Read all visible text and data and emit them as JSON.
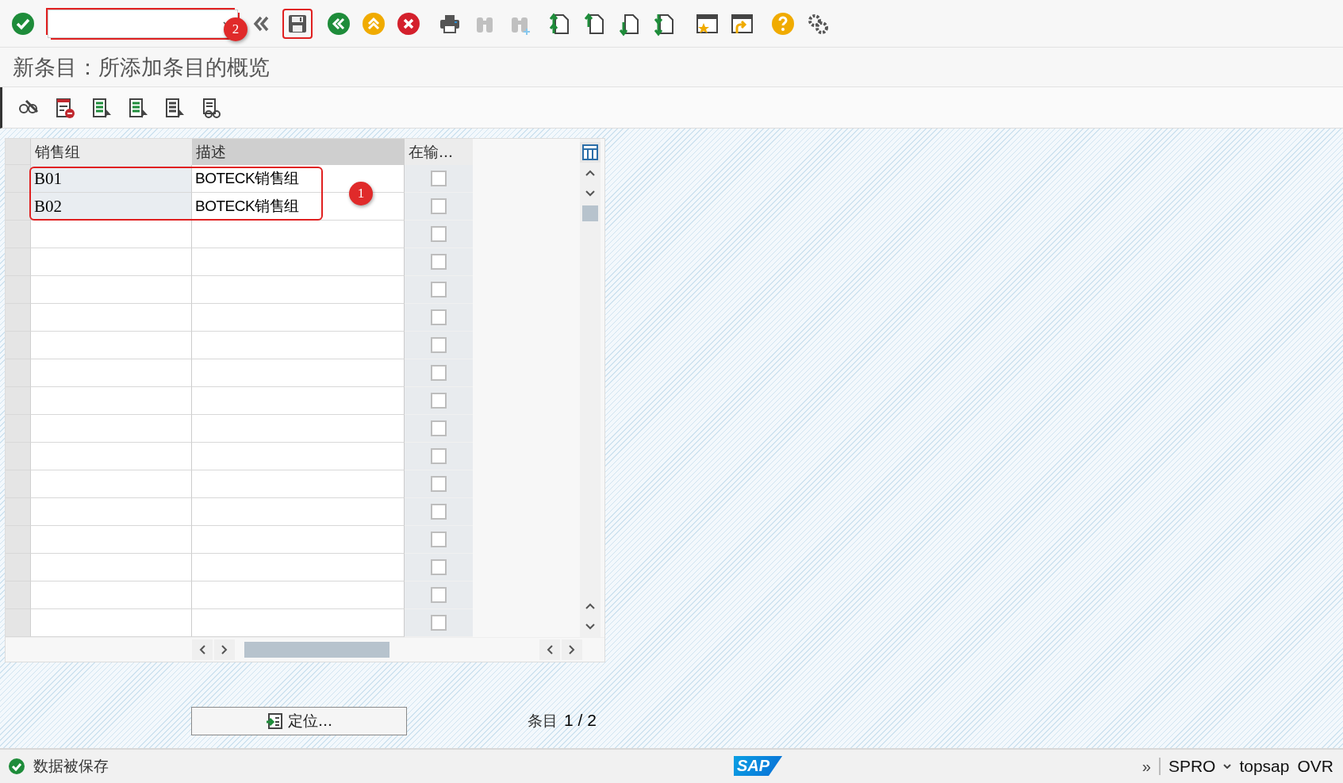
{
  "toolbar": {
    "items": [
      {
        "kind": "enter",
        "disabled": false,
        "highlighted": false
      },
      {
        "kind": "command-field",
        "disabled": false,
        "highlighted": true
      },
      {
        "kind": "collapse",
        "disabled": false,
        "highlighted": false
      },
      {
        "kind": "save",
        "disabled": false,
        "highlighted": true
      },
      {
        "kind": "back",
        "disabled": false,
        "highlighted": false
      },
      {
        "kind": "exit",
        "disabled": false,
        "highlighted": false
      },
      {
        "kind": "cancel",
        "disabled": false,
        "highlighted": false
      },
      {
        "kind": "print",
        "disabled": false,
        "highlighted": false
      },
      {
        "kind": "find",
        "disabled": true,
        "highlighted": false
      },
      {
        "kind": "find-next",
        "disabled": true,
        "highlighted": false
      },
      {
        "kind": "first-page",
        "disabled": false,
        "highlighted": false
      },
      {
        "kind": "previous-page",
        "disabled": false,
        "highlighted": false
      },
      {
        "kind": "next-page",
        "disabled": false,
        "highlighted": false
      },
      {
        "kind": "last-page",
        "disabled": false,
        "highlighted": false
      },
      {
        "kind": "new-session",
        "disabled": false,
        "highlighted": false
      },
      {
        "kind": "shortcut",
        "disabled": false,
        "highlighted": false
      },
      {
        "kind": "help",
        "disabled": false,
        "highlighted": false
      },
      {
        "kind": "settings",
        "disabled": false,
        "highlighted": false
      }
    ]
  },
  "title": "新条目：所添加条目的概览",
  "app_toolbar": [
    {
      "kind": "display-change"
    },
    {
      "kind": "delete"
    },
    {
      "kind": "select-all"
    },
    {
      "kind": "select-block"
    },
    {
      "kind": "deselect-all"
    },
    {
      "kind": "details"
    }
  ],
  "table": {
    "columns": [
      "销售组",
      "描述",
      "在输..."
    ],
    "rows": [
      {
        "group": "B01",
        "description": "BOTECK销售组",
        "checked": false,
        "highlighted": true
      },
      {
        "group": "B02",
        "description": "BOTECK销售组",
        "checked": false,
        "highlighted": true
      },
      {
        "checked": false,
        "highlighted": false
      },
      {
        "checked": false,
        "highlighted": false
      },
      {
        "checked": false,
        "highlighted": false
      },
      {
        "checked": false,
        "highlighted": false
      },
      {
        "checked": false,
        "highlighted": false
      },
      {
        "checked": false,
        "highlighted": false
      },
      {
        "checked": false,
        "highlighted": false
      },
      {
        "checked": false,
        "highlighted": false
      },
      {
        "checked": false,
        "highlighted": false
      },
      {
        "checked": false,
        "highlighted": false
      },
      {
        "checked": false,
        "highlighted": false
      },
      {
        "checked": false,
        "highlighted": false
      },
      {
        "checked": false,
        "highlighted": false
      },
      {
        "checked": false,
        "highlighted": false
      },
      {
        "checked": false,
        "highlighted": false
      }
    ]
  },
  "annotations": [
    {
      "label": "2"
    },
    {
      "label": "1"
    }
  ],
  "position_button": "定位...",
  "entry_label": "条目",
  "entry_count": "1 / 2",
  "status_bar": {
    "message": "数据被保存",
    "logo": "SAP",
    "more": "»",
    "transaction": "SPRO",
    "user": "topsap",
    "mode": "OVR"
  }
}
